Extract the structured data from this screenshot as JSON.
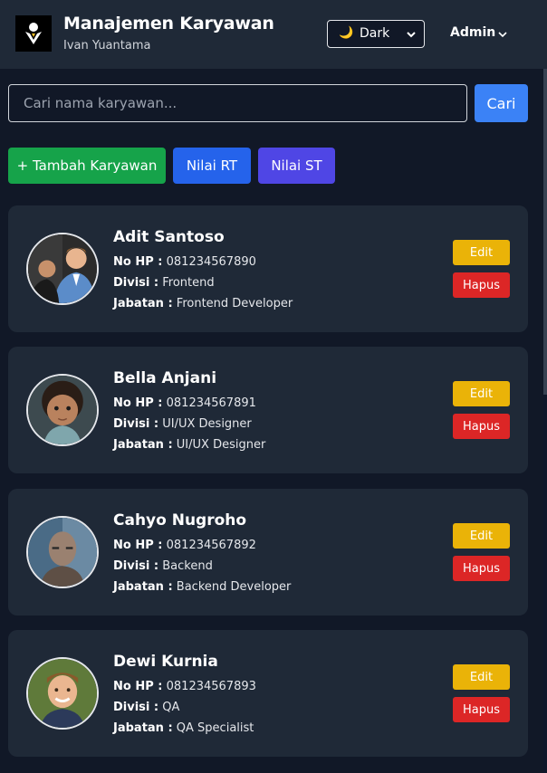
{
  "header": {
    "title": "Manajemen Karyawan",
    "subtitle": "Ivan Yuantama",
    "logo_icon": "user-logo-icon",
    "theme": {
      "icon": "moon-icon",
      "label": "Dark"
    },
    "user_menu": {
      "label": "Admin"
    }
  },
  "search": {
    "placeholder": "Cari nama karyawan...",
    "value": "",
    "button_label": "Cari"
  },
  "actions": {
    "add_label": "+ Tambah Karyawan",
    "rt_label": "Nilai RT",
    "st_label": "Nilai ST"
  },
  "labels": {
    "phone": "No HP :",
    "division": "Divisi :",
    "position": "Jabatan :",
    "edit": "Edit",
    "delete": "Hapus"
  },
  "colors": {
    "background": "#111827",
    "surface": "#1f2937",
    "add": "#16a34a",
    "rt": "#2563eb",
    "st": "#4f46e5",
    "edit": "#eab308",
    "delete": "#dc2626"
  },
  "employees": [
    {
      "name": "Adit Santoso",
      "phone": "081234567890",
      "division": "Frontend",
      "position": "Frontend Developer"
    },
    {
      "name": "Bella Anjani",
      "phone": "081234567891",
      "division": "UI/UX Designer",
      "position": "UI/UX Designer"
    },
    {
      "name": "Cahyo Nugroho",
      "phone": "081234567892",
      "division": "Backend",
      "position": "Backend Developer"
    },
    {
      "name": "Dewi Kurnia",
      "phone": "081234567893",
      "division": "QA",
      "position": "QA Specialist"
    }
  ]
}
